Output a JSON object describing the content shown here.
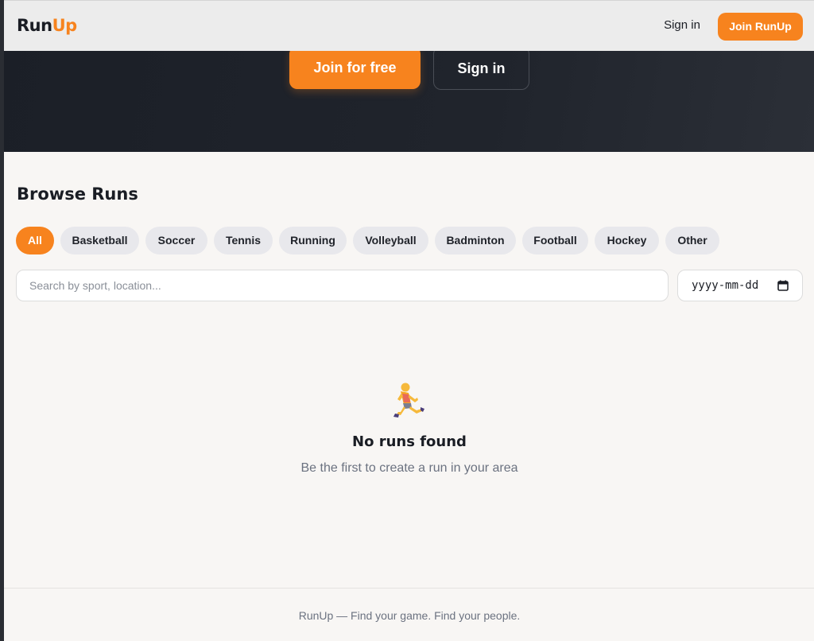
{
  "nav": {
    "logo_part1": "Run",
    "logo_part2": "Up",
    "signin": "Sign in",
    "join": "Join RunUp"
  },
  "hero": {
    "join_free": "Join for free",
    "signin": "Sign in"
  },
  "browse": {
    "title": "Browse Runs",
    "filters": [
      "All",
      "Basketball",
      "Soccer",
      "Tennis",
      "Running",
      "Volleyball",
      "Badminton",
      "Football",
      "Hockey",
      "Other"
    ],
    "active_filter": "All",
    "search_placeholder": "Search by sport, location...",
    "date_placeholder": "yyyy-mm-dd"
  },
  "empty": {
    "icon": "runner-icon",
    "title": "No runs found",
    "subtitle": "Be the first to create a run in your area"
  },
  "footer": {
    "text": "RunUp — Find your game. Find your people."
  },
  "colors": {
    "accent": "#f7831e",
    "dark": "#1b1f27",
    "background": "#f8f6f4"
  }
}
